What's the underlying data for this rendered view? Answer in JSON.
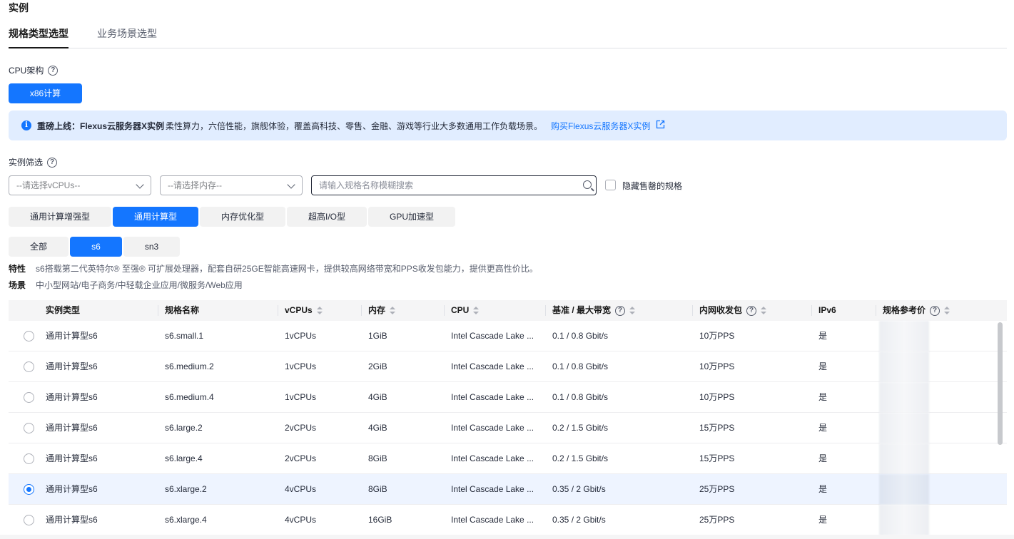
{
  "section_title": "实例",
  "tabs": [
    {
      "label": "规格类型选型",
      "active": true
    },
    {
      "label": "业务场景选型",
      "active": false
    }
  ],
  "cpu_arch": {
    "label": "CPU架构",
    "options": [
      "x86计算"
    ],
    "selected": "x86计算"
  },
  "notice": {
    "title": "重磅上线：Flexus云服务器X实例",
    "text": "柔性算力，六倍性能，旗舰体验，覆盖高科技、零售、金融、游戏等行业大多数通用工作负载场景。",
    "link": "购买Flexus云服务器X实例"
  },
  "filter": {
    "label": "实例筛选",
    "vcpu_placeholder": "--请选择vCPUs--",
    "memory_placeholder": "--请选择内存--",
    "search_placeholder": "请输入规格名称模糊搜索",
    "hide_soldout_label": "隐藏售罄的规格"
  },
  "categories": [
    {
      "label": "通用计算增强型",
      "active": false
    },
    {
      "label": "通用计算型",
      "active": true
    },
    {
      "label": "内存优化型",
      "active": false
    },
    {
      "label": "超高I/O型",
      "active": false
    },
    {
      "label": "GPU加速型",
      "active": false
    }
  ],
  "series": [
    {
      "label": "全部",
      "active": false
    },
    {
      "label": "s6",
      "active": true
    },
    {
      "label": "sn3",
      "active": false
    }
  ],
  "description": {
    "feature_key": "特性",
    "feature": "s6搭载第二代英特尔® 至强® 可扩展处理器，配套自研25GE智能高速网卡，提供较高网络带宽和PPS收发包能力，提供更高性价比。",
    "scenario_key": "场景",
    "scenario": "中小型网站/电子商务/中轻载企业应用/微服务/Web应用"
  },
  "table": {
    "headers": {
      "type": "实例类型",
      "name": "规格名称",
      "vcpus": "vCPUs",
      "memory": "内存",
      "cpu": "CPU",
      "bandwidth": "基准 / 最大带宽",
      "pps": "内网收发包",
      "ipv6": "IPv6",
      "price": "规格参考价"
    },
    "rows": [
      {
        "type": "通用计算型s6",
        "name": "s6.small.1",
        "vcpus": "1vCPUs",
        "memory": "1GiB",
        "cpu": "Intel Cascade Lake ...",
        "bandwidth": "0.1 / 0.8 Gbit/s",
        "pps": "10万PPS",
        "ipv6": "是",
        "selected": false
      },
      {
        "type": "通用计算型s6",
        "name": "s6.medium.2",
        "vcpus": "1vCPUs",
        "memory": "2GiB",
        "cpu": "Intel Cascade Lake ...",
        "bandwidth": "0.1 / 0.8 Gbit/s",
        "pps": "10万PPS",
        "ipv6": "是",
        "selected": false
      },
      {
        "type": "通用计算型s6",
        "name": "s6.medium.4",
        "vcpus": "1vCPUs",
        "memory": "4GiB",
        "cpu": "Intel Cascade Lake ...",
        "bandwidth": "0.1 / 0.8 Gbit/s",
        "pps": "10万PPS",
        "ipv6": "是",
        "selected": false
      },
      {
        "type": "通用计算型s6",
        "name": "s6.large.2",
        "vcpus": "2vCPUs",
        "memory": "4GiB",
        "cpu": "Intel Cascade Lake ...",
        "bandwidth": "0.2 / 1.5 Gbit/s",
        "pps": "15万PPS",
        "ipv6": "是",
        "selected": false
      },
      {
        "type": "通用计算型s6",
        "name": "s6.large.4",
        "vcpus": "2vCPUs",
        "memory": "8GiB",
        "cpu": "Intel Cascade Lake ...",
        "bandwidth": "0.2 / 1.5 Gbit/s",
        "pps": "15万PPS",
        "ipv6": "是",
        "selected": false
      },
      {
        "type": "通用计算型s6",
        "name": "s6.xlarge.2",
        "vcpus": "4vCPUs",
        "memory": "8GiB",
        "cpu": "Intel Cascade Lake ...",
        "bandwidth": "0.35 / 2 Gbit/s",
        "pps": "25万PPS",
        "ipv6": "是",
        "selected": true
      },
      {
        "type": "通用计算型s6",
        "name": "s6.xlarge.4",
        "vcpus": "4vCPUs",
        "memory": "16GiB",
        "cpu": "Intel Cascade Lake ...",
        "bandwidth": "0.35 / 2 Gbit/s",
        "pps": "25万PPS",
        "ipv6": "是",
        "selected": false
      }
    ]
  },
  "colors": {
    "primary": "#1476ff",
    "notice_bg": "#e1edff"
  }
}
